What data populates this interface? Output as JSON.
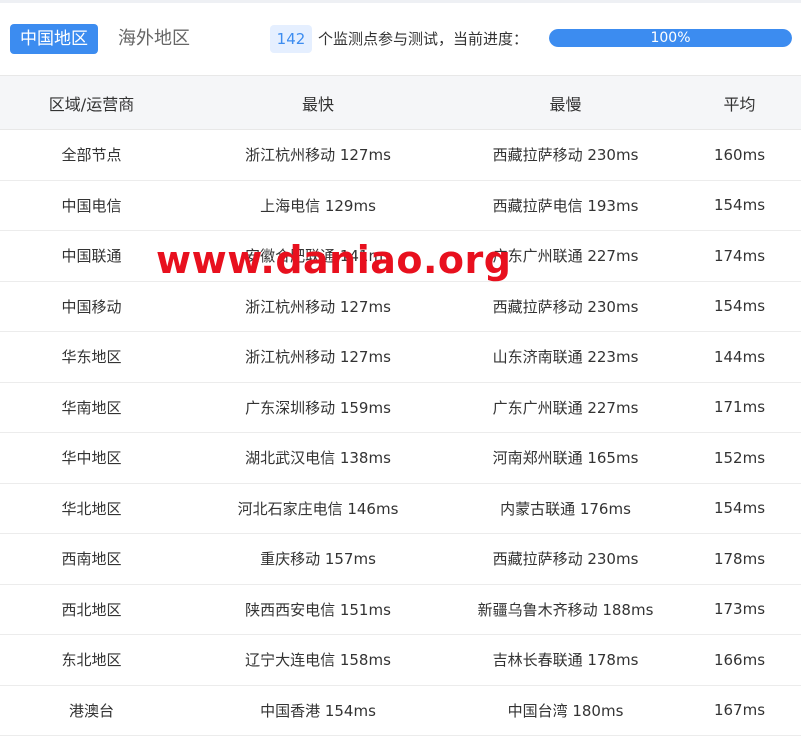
{
  "tabs": [
    {
      "label": "中国地区",
      "active": true
    },
    {
      "label": "海外地区",
      "active": false
    }
  ],
  "progress": {
    "count": "142",
    "text": "个监测点参与测试，当前进度：",
    "percent_label": "100%",
    "percent": 100
  },
  "table": {
    "headers": [
      "区域/运营商",
      "最快",
      "最慢",
      "平均"
    ],
    "rows": [
      [
        "全部节点",
        "浙江杭州移动 127ms",
        "西藏拉萨移动 230ms",
        "160ms"
      ],
      [
        "中国电信",
        "上海电信 129ms",
        "西藏拉萨电信 193ms",
        "154ms"
      ],
      [
        "中国联通",
        "安徽合肥联通 141ms",
        "广东广州联通 227ms",
        "174ms"
      ],
      [
        "中国移动",
        "浙江杭州移动 127ms",
        "西藏拉萨移动 230ms",
        "154ms"
      ],
      [
        "华东地区",
        "浙江杭州移动 127ms",
        "山东济南联通 223ms",
        "144ms"
      ],
      [
        "华南地区",
        "广东深圳移动 159ms",
        "广东广州联通 227ms",
        "171ms"
      ],
      [
        "华中地区",
        "湖北武汉电信 138ms",
        "河南郑州联通 165ms",
        "152ms"
      ],
      [
        "华北地区",
        "河北石家庄电信 146ms",
        "内蒙古联通 176ms",
        "154ms"
      ],
      [
        "西南地区",
        "重庆移动 157ms",
        "西藏拉萨移动 230ms",
        "178ms"
      ],
      [
        "西北地区",
        "陕西西安电信 151ms",
        "新疆乌鲁木齐移动 188ms",
        "173ms"
      ],
      [
        "东北地区",
        "辽宁大连电信 158ms",
        "吉林长春联通 178ms",
        "166ms"
      ],
      [
        "港澳台",
        "中国香港 154ms",
        "中国台湾 180ms",
        "167ms"
      ]
    ]
  },
  "watermark": "www.daniao.org",
  "colors": {
    "accent": "#3c8cf0",
    "watermark": "#e8101e"
  }
}
